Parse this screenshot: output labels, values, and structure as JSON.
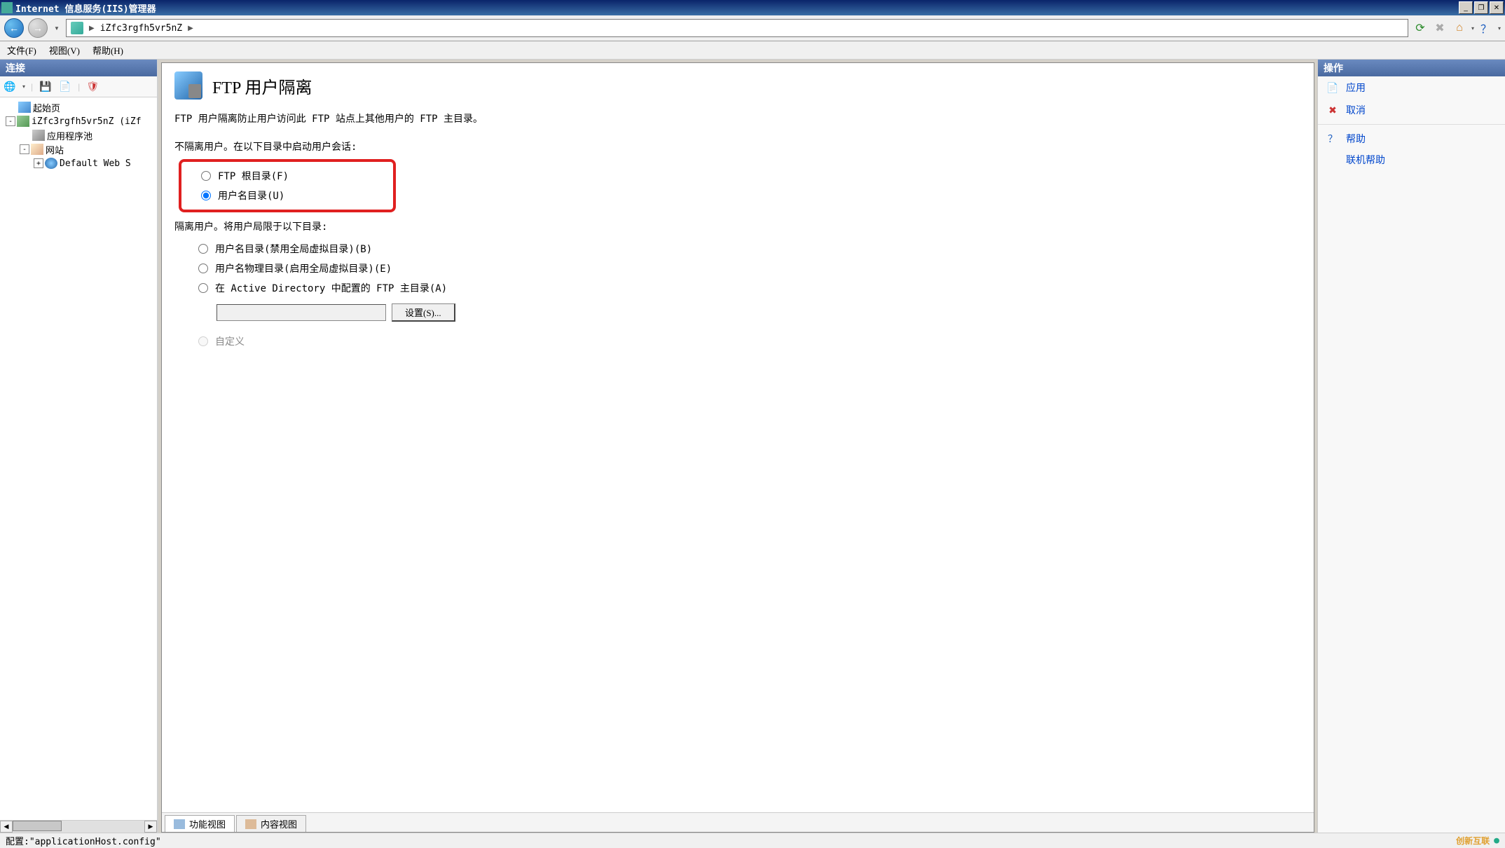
{
  "titlebar": {
    "text": "Internet 信息服务(IIS)管理器"
  },
  "address": {
    "server": "iZfc3rgfh5vr5nZ"
  },
  "menu": {
    "file": "文件(F)",
    "view": "视图(V)",
    "help": "帮助(H)"
  },
  "left": {
    "header": "连接",
    "tree": {
      "start": "起始页",
      "server": "iZfc3rgfh5vr5nZ (iZf",
      "apppool": "应用程序池",
      "sites": "网站",
      "default": "Default Web S"
    }
  },
  "center": {
    "title": "FTP 用户隔离",
    "desc": "FTP 用户隔离防止用户访问此 FTP 站点上其他用户的 FTP 主目录。",
    "sec1": "不隔离用户。在以下目录中启动用户会话:",
    "r1": "FTP 根目录(F)",
    "r2": "用户名目录(U)",
    "sec2": "隔离用户。将用户局限于以下目录:",
    "r3": "用户名目录(禁用全局虚拟目录)(B)",
    "r4": "用户名物理目录(启用全局虚拟目录)(E)",
    "r5": "在 Active Directory 中配置的 FTP 主目录(A)",
    "setbtn": "设置(S)...",
    "r6": "自定义",
    "tab1": "功能视图",
    "tab2": "内容视图"
  },
  "right": {
    "header": "操作",
    "apply": "应用",
    "cancel": "取消",
    "help": "帮助",
    "online": "联机帮助"
  },
  "status": {
    "text": "配置:\"applicationHost.config\"",
    "watermark": "创新互联"
  }
}
